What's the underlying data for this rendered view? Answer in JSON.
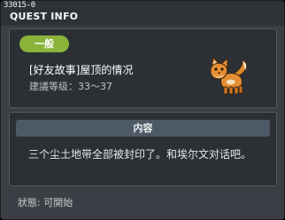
{
  "window": {
    "quest_id": "33015-0",
    "title": "QUEST INFO"
  },
  "quest": {
    "category": "一般",
    "name": "[好友故事]屋顶的情况",
    "level_text": "建議等级：33～37",
    "npc_icon": "fox-npc-icon"
  },
  "details": {
    "header": "内容",
    "text": "三个尘土地带全部被封印了。和埃尔文对话吧。"
  },
  "status": {
    "text": "狀態:  可開始"
  },
  "colors": {
    "badge_green": "#8ab43a",
    "content_header": "#4d5964",
    "window_bg": "#3b3f45",
    "panel_bg": "#2c3035"
  }
}
